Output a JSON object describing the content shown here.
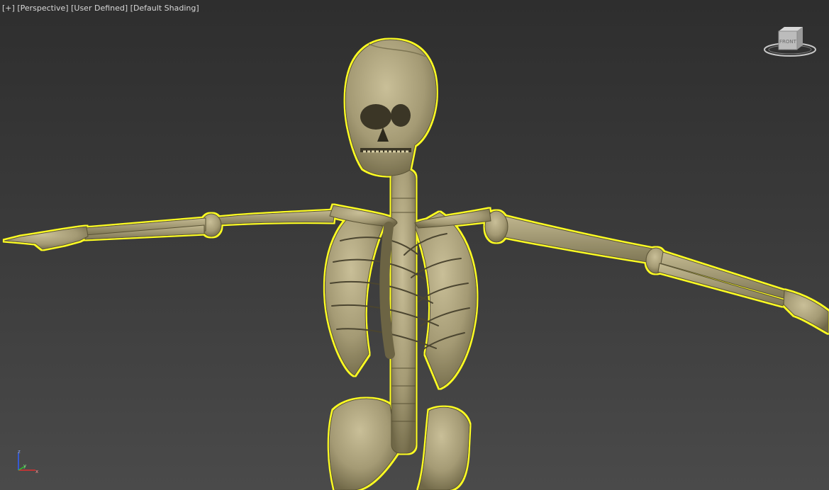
{
  "viewport": {
    "labels": {
      "plus": "[+]",
      "view": "[Perspective]",
      "visual_style": "[User Defined]",
      "shading": "[Default Shading]"
    },
    "viewcube_face": "FRONT",
    "selection_highlight_color": "#ffff20",
    "bone_color": "#a49a74",
    "background_top": "#2e2e2e",
    "background_bottom": "#4a4a4a"
  },
  "axis_tripod": {
    "z": "z",
    "y": "y",
    "x": "x"
  },
  "scene": {
    "object": "skeleton",
    "selected": true,
    "icons": [
      "viewcube-icon",
      "axis-tripod-icon"
    ]
  }
}
